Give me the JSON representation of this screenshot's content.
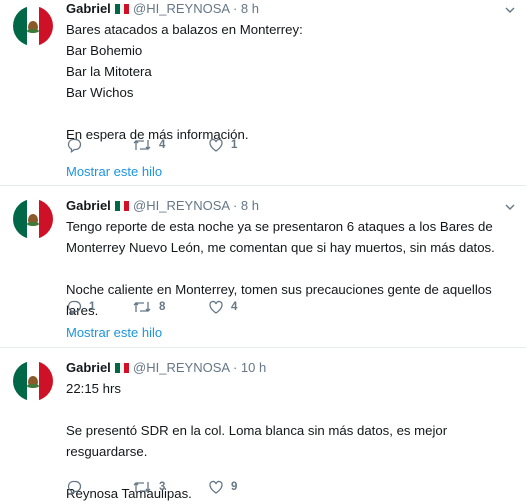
{
  "tweets": [
    {
      "name": "Gabriel",
      "handle": "@HI_REYNOSA",
      "separator": "·",
      "time": "8 h",
      "text": "Bares atacados a balazos en Monterrey:\nBar Bohemio\nBar la Mitotera\nBar Wichos\n\nEn espera de más información.",
      "replies": "",
      "retweets": "4",
      "likes": "1",
      "show_thread": "Mostrar este hilo"
    },
    {
      "name": "Gabriel",
      "handle": "@HI_REYNOSA",
      "separator": "·",
      "time": "8 h",
      "text": "Tengo reporte de esta noche ya se presentaron 6 ataques a los Bares de Monterrey Nuevo León, me comentan que si hay muertos, sin más datos.\n\nNoche caliente en Monterrey, tomen sus precauciones gente de aquellos lares.",
      "replies": "1",
      "retweets": "8",
      "likes": "4",
      "show_thread": "Mostrar este hilo"
    },
    {
      "name": "Gabriel",
      "handle": "@HI_REYNOSA",
      "separator": "·",
      "time": "10 h",
      "text": "22:15 hrs\n\nSe presentó SDR en la col. Loma blanca sin más datos, es mejor resguardarse.\n\nReynosa Tamaulipas.",
      "replies": "",
      "retweets": "3",
      "likes": "9"
    }
  ],
  "colors": {
    "text": "#14171a",
    "muted": "#657786",
    "link": "#1b95e0",
    "divider": "#e6ecf0"
  },
  "icons": [
    "mexico-flag-avatar",
    "reply-icon",
    "retweet-icon",
    "like-icon",
    "chevron-down-icon"
  ]
}
